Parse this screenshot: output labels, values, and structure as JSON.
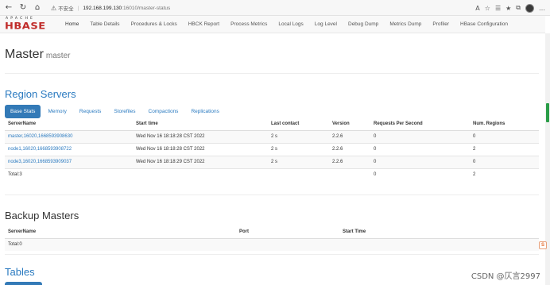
{
  "browser": {
    "security_label": "不安全",
    "url_host": "192.168.199.130",
    "url_path": ":16010/master-status"
  },
  "navbar": {
    "items": [
      "Home",
      "Table Details",
      "Procedures & Locks",
      "HBCK Report",
      "Process Metrics",
      "Local Logs",
      "Log Level",
      "Debug Dump",
      "Metrics Dump",
      "Profiler",
      "HBase Configuration"
    ],
    "logo_top": "APACHE",
    "logo_main": "HBASE"
  },
  "page": {
    "title": "Master",
    "subtitle": "master"
  },
  "region_servers": {
    "title": "Region Servers",
    "tabs": [
      "Base Stats",
      "Memory",
      "Requests",
      "Storefiles",
      "Compactions",
      "Replications"
    ],
    "columns": [
      "ServerName",
      "Start time",
      "Last contact",
      "Version",
      "Requests Per Second",
      "Num. Regions"
    ],
    "rows": [
      [
        "master,16020,1668593908630",
        "Wed Nov 16 18:18:28 CST 2022",
        "2 s",
        "2.2.6",
        "0",
        "0"
      ],
      [
        "node1,16020,1668593908722",
        "Wed Nov 16 18:18:28 CST 2022",
        "2 s",
        "2.2.6",
        "0",
        "2"
      ],
      [
        "node3,16020,1668593909037",
        "Wed Nov 16 18:18:29 CST 2022",
        "2 s",
        "2.2.6",
        "0",
        "0"
      ]
    ],
    "total_label": "Total:3",
    "total_requests": "0",
    "total_regions": "2"
  },
  "backup_masters": {
    "title": "Backup Masters",
    "columns": [
      "ServerName",
      "Port",
      "Start Time"
    ],
    "total_label": "Total:0"
  },
  "tables": {
    "title": "Tables"
  },
  "watermark": "CSDN @仄言2997"
}
